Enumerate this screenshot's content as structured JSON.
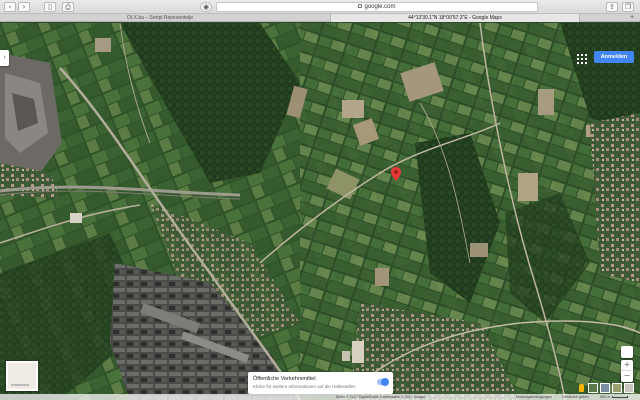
{
  "browser": {
    "url": "google.com",
    "tabs": [
      {
        "label": "OLX.ba – Sretpl Repesentelje",
        "active": false
      },
      {
        "label": "44°13'30.1\"N 18°00'57.3\"E - Google Maps",
        "active": true
      }
    ]
  },
  "map": {
    "signin_label": "Anmelden",
    "transit_title": "Öffentliche Verkehrsmittel",
    "transit_subtitle": "Klicke für weitere Informationen auf die Haltestellen",
    "zoom_in": "+",
    "zoom_out": "−",
    "footer": {
      "imagery": "Bilder © 2017 DigitalGlobe, Kartendaten © 2017 Google",
      "terms": "Nutzungsbedingungen",
      "feedback": "Feedback geben",
      "scale": "500 m"
    },
    "icons": {
      "pin": "red-map-pin",
      "apps": "apps-grid",
      "pegman": "pegman",
      "locate": "my-location"
    },
    "colors": {
      "pin": "#e53935",
      "signin": "#4285f4",
      "pegman": "#f7b500"
    }
  }
}
